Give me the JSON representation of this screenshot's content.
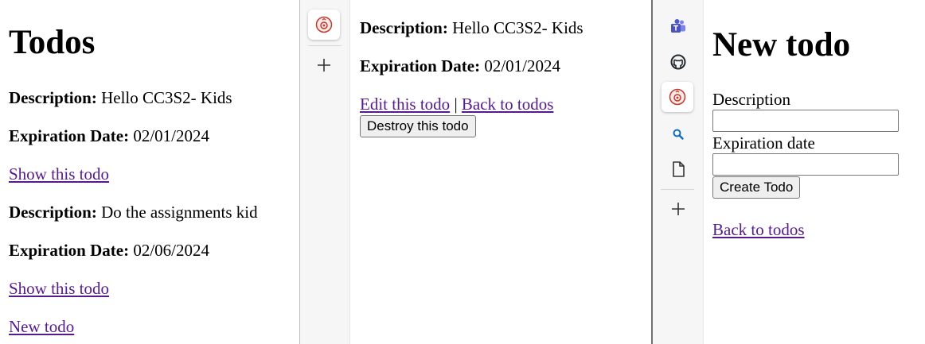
{
  "index_page": {
    "title": "Todos",
    "todos": [
      {
        "description_label": "Description:",
        "description": "Hello CC3S2- Kids",
        "expiration_label": "Expiration Date:",
        "expiration": "02/01/2024",
        "show_link": "Show this todo"
      },
      {
        "description_label": "Description:",
        "description": "Do the assignments kid",
        "expiration_label": "Expiration Date:",
        "expiration": "02/06/2024",
        "show_link": "Show this todo"
      }
    ],
    "new_link": "New todo"
  },
  "sidebar_left": {
    "items": [
      {
        "icon": "app-logo-icon"
      },
      {
        "icon": "plus-icon"
      }
    ]
  },
  "show_page": {
    "description_label": "Description:",
    "description": "Hello CC3S2- Kids",
    "expiration_label": "Expiration Date:",
    "expiration": "02/01/2024",
    "edit_link": "Edit this todo",
    "separator": "|",
    "back_link": "Back to todos",
    "destroy_button": "Destroy this todo"
  },
  "sidebar_right": {
    "items": [
      {
        "icon": "teams-icon",
        "color": "#5059c9"
      },
      {
        "icon": "github-icon",
        "color": "#24292f"
      },
      {
        "icon": "app-logo-icon",
        "color": "#c0392b"
      },
      {
        "icon": "search-icon",
        "color": "#0f6cbd"
      },
      {
        "icon": "document-icon",
        "color": "#333333"
      },
      {
        "icon": "plus-icon",
        "color": "#333333"
      }
    ]
  },
  "new_page": {
    "title": "New todo",
    "description_label": "Description",
    "description_value": "",
    "expiration_label": "Expiration date",
    "expiration_value": "",
    "submit_button": "Create Todo",
    "back_link": "Back to todos"
  },
  "colors": {
    "link": "#551a8b",
    "sidebar_bg": "#f6f6f6"
  }
}
